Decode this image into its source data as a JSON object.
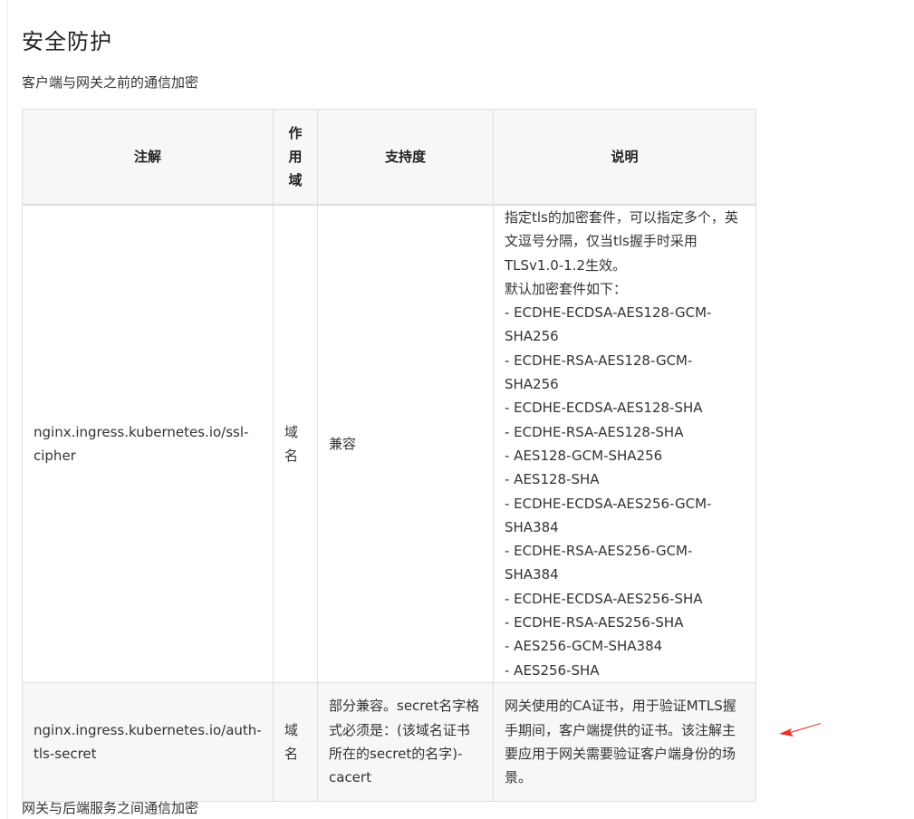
{
  "section": {
    "title": "安全防护",
    "subtitle": "客户端与网关之前的通信加密",
    "footer_text": "网关与后端服务之间通信加密"
  },
  "table": {
    "headers": {
      "annotation": "注解",
      "scope": "作用域",
      "support": "支持度",
      "description": "说明"
    },
    "rows": [
      {
        "annotation": "nginx.ingress.kubernetes.io/ssl-cipher",
        "scope": "域名",
        "support": "兼容",
        "description_lines": [
          "指定tls的加密套件，可以指定多个，英文逗号分隔，仅当tls握手时采用TLSv1.0-1.2生效。",
          "默认加密套件如下：",
          "- ECDHE-ECDSA-AES128-GCM-SHA256",
          "- ECDHE-RSA-AES128-GCM-SHA256",
          "- ECDHE-ECDSA-AES128-SHA",
          "- ECDHE-RSA-AES128-SHA",
          "- AES128-GCM-SHA256",
          "- AES128-SHA",
          "- ECDHE-ECDSA-AES256-GCM-SHA384",
          "- ECDHE-RSA-AES256-GCM-SHA384",
          "- ECDHE-ECDSA-AES256-SHA",
          "- ECDHE-RSA-AES256-SHA",
          "- AES256-GCM-SHA384",
          "- AES256-SHA"
        ]
      },
      {
        "annotation": "nginx.ingress.kubernetes.io/auth-tls-secret",
        "scope": "域名",
        "support": "部分兼容。secret名字格式必须是：(该域名证书所在的secret的名字)-cacert",
        "description_lines": [
          "网关使用的CA证书，用于验证MTLS握手期间，客户端提供的证书。该注解主要应用于网关需要验证客户端身份的场景。"
        ]
      }
    ]
  },
  "colors": {
    "header_bg": "#f7f7f7",
    "border": "#dfdfdf",
    "arrow": "#e8322e"
  }
}
